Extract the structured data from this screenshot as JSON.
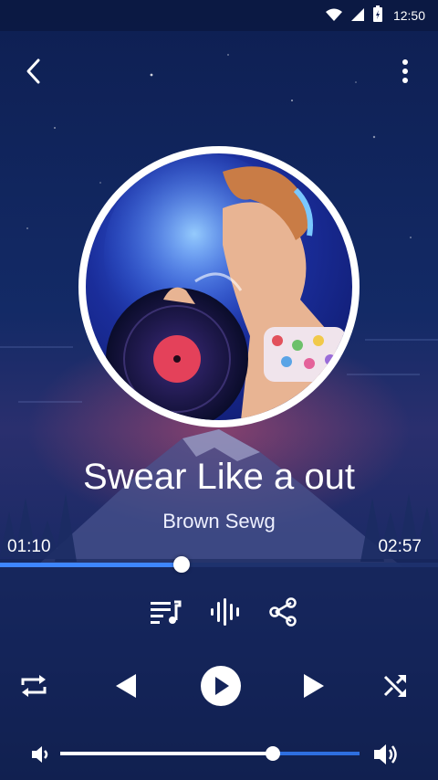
{
  "status_bar": {
    "time": "12:50",
    "icons": [
      "wifi-icon",
      "signal-icon",
      "battery-charging-icon"
    ]
  },
  "top_bar": {
    "back_icon": "chevron-left-icon",
    "menu_icon": "more-vertical-icon"
  },
  "now_playing": {
    "title": "Swear Like a out",
    "artist": "Brown Sewg",
    "elapsed": "01:10",
    "duration": "02:57",
    "progress": 0.415
  },
  "secondary_controls": [
    "playlist-icon",
    "equalizer-icon",
    "share-icon"
  ],
  "playback_controls": [
    "repeat-icon",
    "previous-icon",
    "play-icon",
    "next-icon",
    "shuffle-icon"
  ],
  "volume": {
    "level": 0.71,
    "low_icon": "volume-low-icon",
    "high_icon": "volume-high-icon"
  },
  "colors": {
    "accent": "#3e86ff",
    "background": "#0e1e4a"
  }
}
